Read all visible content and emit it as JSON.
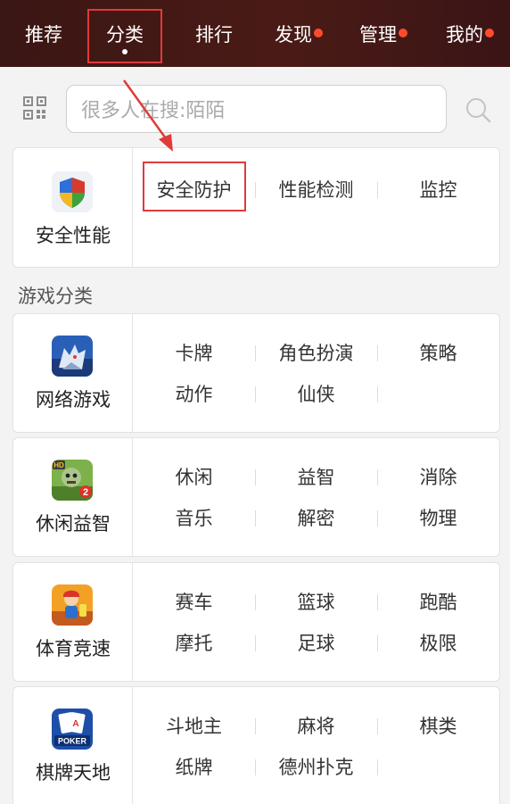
{
  "nav": {
    "items": [
      {
        "label": "推荐",
        "dot": false
      },
      {
        "label": "分类",
        "dot": false,
        "active": true
      },
      {
        "label": "排行",
        "dot": false
      },
      {
        "label": "发现",
        "dot": true
      },
      {
        "label": "管理",
        "dot": true
      },
      {
        "label": "我的",
        "dot": true
      }
    ]
  },
  "search": {
    "placeholder": "很多人在搜:陌陌"
  },
  "security_card": {
    "label": "安全性能",
    "icon": "shield-icon",
    "items": [
      "安全防护",
      "性能检测",
      "监控"
    ]
  },
  "games_section": {
    "title": "游戏分类",
    "cards": [
      {
        "label": "网络游戏",
        "icon": "wolf-game-icon",
        "rows": [
          [
            "卡牌",
            "角色扮演",
            "策略"
          ],
          [
            "动作",
            "仙侠",
            ""
          ]
        ]
      },
      {
        "label": "休闲益智",
        "icon": "zombie-game-icon",
        "rows": [
          [
            "休闲",
            "益智",
            "消除"
          ],
          [
            "音乐",
            "解密",
            "物理"
          ]
        ]
      },
      {
        "label": "体育竞速",
        "icon": "runner-game-icon",
        "rows": [
          [
            "赛车",
            "篮球",
            "跑酷"
          ],
          [
            "摩托",
            "足球",
            "极限"
          ]
        ]
      },
      {
        "label": "棋牌天地",
        "icon": "poker-icon",
        "rows": [
          [
            "斗地主",
            "麻将",
            "棋类"
          ],
          [
            "纸牌",
            "德州扑克",
            ""
          ]
        ]
      }
    ]
  },
  "icon_text": {
    "hd": "HD",
    "two": "2",
    "poker": "POKER"
  },
  "colors": {
    "nav_bg": "#3f1815",
    "notify_dot": "#ff4b2b",
    "annotation_red": "#e03a3a"
  }
}
